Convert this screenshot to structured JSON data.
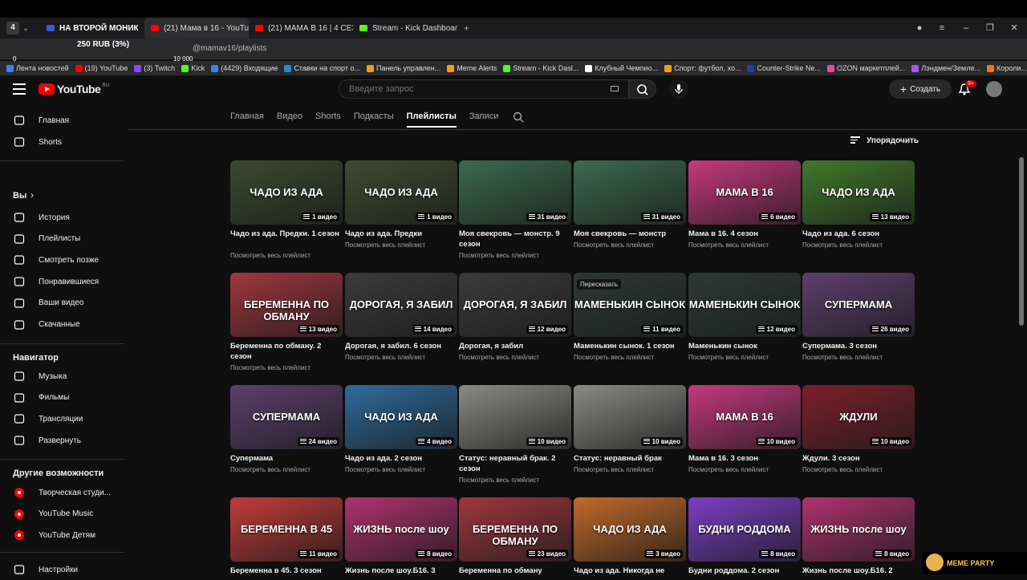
{
  "browser": {
    "tab_count_badge": "4",
    "tabs": [
      {
        "label": "НА ВТОРОЙ МОНИК",
        "color": "#3b5bdb"
      },
      {
        "label": "(21) Мама в 16 - YouTube",
        "color": "#ff0000",
        "active": true
      },
      {
        "label": "(21) МАМА В 16 | 4 СЕЗОН",
        "color": "#ff0000"
      },
      {
        "label": "Stream - Kick Dashboard",
        "color": "#53fc18"
      }
    ],
    "address": "@mamav16/playlists",
    "overlay_money": "250 RUB (3%)",
    "overlay_min": "0",
    "overlay_max": "10 000",
    "bookmarks": [
      {
        "label": "Лента новостей",
        "color": "#3b82f6"
      },
      {
        "label": "(19) YouTube",
        "color": "#ff0000"
      },
      {
        "label": "(3) Twitch",
        "color": "#9146ff"
      },
      {
        "label": "Kick",
        "color": "#53fc18"
      },
      {
        "label": "(4429) Входящие",
        "color": "#3b82f6"
      },
      {
        "label": "Ставки на спорт о...",
        "color": "#2a8bd5"
      },
      {
        "label": "Панель управлен...",
        "color": "#f59e0b"
      },
      {
        "label": "Meme Alerts",
        "color": "#f59e0b"
      },
      {
        "label": "Stream - Kick Dasl...",
        "color": "#53fc18"
      },
      {
        "label": "Клубный Чемпио...",
        "color": "#ffffff"
      },
      {
        "label": "Спорт: футбол, хо...",
        "color": "#f59e0b"
      },
      {
        "label": "Counter-Strike Ne...",
        "color": "#1e40af"
      },
      {
        "label": "OZON маркетплей...",
        "color": "#ec4899"
      },
      {
        "label": "Лэндмен/Земле...",
        "color": "#a855f7"
      },
      {
        "label": "Короли...",
        "color": "#f97316"
      }
    ]
  },
  "masthead": {
    "logo_text": "YouTube",
    "logo_region": "RU",
    "search_placeholder": "Введите запрос",
    "create_label": "Создать",
    "notif_count": "9+"
  },
  "sidebar": {
    "main": [
      {
        "label": "Главная",
        "icon": "home-icon"
      },
      {
        "label": "Shorts",
        "icon": "shorts-icon"
      }
    ],
    "you_header": "Вы",
    "you": [
      {
        "label": "История",
        "icon": "history-icon"
      },
      {
        "label": "Плейлисты",
        "icon": "playlists-icon"
      },
      {
        "label": "Смотреть позже",
        "icon": "clock-icon"
      },
      {
        "label": "Понравившиеся",
        "icon": "thumbs-up-icon"
      },
      {
        "label": "Ваши видео",
        "icon": "video-icon"
      },
      {
        "label": "Скачанные",
        "icon": "download-icon"
      }
    ],
    "nav_header": "Навигатор",
    "nav": [
      {
        "label": "Музыка",
        "icon": "music-icon"
      },
      {
        "label": "Фильмы",
        "icon": "film-icon"
      },
      {
        "label": "Трансляции",
        "icon": "live-icon"
      },
      {
        "label": "Развернуть",
        "icon": "chevron-down-icon"
      }
    ],
    "more_header": "Другие возможности",
    "more": [
      {
        "label": "Творческая студи...",
        "icon": "studio-icon"
      },
      {
        "label": "YouTube Music",
        "icon": "yt-music-icon"
      },
      {
        "label": "YouTube Детям",
        "icon": "yt-kids-icon"
      }
    ],
    "settings": "Настройки"
  },
  "channel_tabs": [
    "Главная",
    "Видео",
    "Shorts",
    "Подкасты",
    "Плейлисты",
    "Записи"
  ],
  "active_tab": "Плейлисты",
  "sort_label": "Упорядочить",
  "see_all": "Посмотреть весь плейлист",
  "playlists": [
    {
      "title": "Чадо из ада. Предки. 1 сезон",
      "count": "1 видео",
      "bg": "#3b4a2e",
      "art": "ЧАДО ИЗ АДА",
      "two_line": true
    },
    {
      "title": "Чадо из ада. Предки",
      "count": "1 видео",
      "bg": "#3e4b30",
      "art": "ЧАДО ИЗ АДА",
      "two_line": false
    },
    {
      "title": "Моя свекровь — монстр. 9 сезон",
      "count": "31 видео",
      "bg": "#3a6b4f",
      "art": "",
      "two_line": true
    },
    {
      "title": "Моя свекровь — монстр",
      "count": "31 видео",
      "bg": "#3a6b4f",
      "art": "",
      "two_line": false
    },
    {
      "title": "Мама в 16. 4 сезон",
      "count": "6 видео",
      "bg": "#c7387f",
      "art": "МАМА В 16",
      "two_line": false
    },
    {
      "title": "Чадо из ада. 6 сезон",
      "count": "13 видео",
      "bg": "#3f7a2a",
      "art": "ЧАДО ИЗ АДА",
      "two_line": false
    },
    {
      "title": "Беременна по обману. 2 сезон",
      "count": "13 видео",
      "bg": "#a0373f",
      "art": "БЕРЕМЕННА ПО ОБМАНУ",
      "two_line": true
    },
    {
      "title": "Дорогая, я забил. 6 сезон",
      "count": "14 видео",
      "bg": "#3b3b3b",
      "art": "ДОРОГАЯ, Я ЗАБИЛ",
      "two_line": false
    },
    {
      "title": "Дорогая, я забил",
      "count": "12 видео",
      "bg": "#3b3b3b",
      "art": "ДОРОГАЯ, Я ЗАБИЛ",
      "two_line": false
    },
    {
      "title": "Маменькин сынок. 1 сезон",
      "count": "11 видео",
      "bg": "#2c3a34",
      "art": "МАМЕНЬКИН СЫНОК",
      "two_line": false
    },
    {
      "title": "Маменькин сынок",
      "count": "12 видео",
      "bg": "#2c3a34",
      "art": "МАМЕНЬКИН СЫНОК",
      "two_line": false
    },
    {
      "title": "Супермама. 3 сезон",
      "count": "26 видео",
      "bg": "#5e3f6e",
      "art": "СУПЕРМАМА",
      "two_line": false
    },
    {
      "title": "Супермама",
      "count": "24 видео",
      "bg": "#5e3f6e",
      "art": "СУПЕРМАМА",
      "two_line": false
    },
    {
      "title": "Чадо из ада. 2 сезон",
      "count": "4 видео",
      "bg": "#2e6c9e",
      "art": "ЧАДО ИЗ АДА",
      "two_line": false
    },
    {
      "title": "Статус: неравный брак. 2 сезон",
      "count": "10 видео",
      "bg": "#8a8a86",
      "art": "",
      "two_line": true
    },
    {
      "title": "Статус: неравный брак",
      "count": "10 видео",
      "bg": "#8a8a86",
      "art": "",
      "two_line": false
    },
    {
      "title": "Мама в 16. 3 сезон",
      "count": "10 видео",
      "bg": "#c7387f",
      "art": "МАМА В 16",
      "two_line": false
    },
    {
      "title": "Ждули. 3 сезон",
      "count": "10 видео",
      "bg": "#7d1f2a",
      "art": "ЖДУЛИ",
      "two_line": false
    },
    {
      "title": "Беременна в 45. 3 сезон",
      "count": "11 видео",
      "bg": "#c23c39",
      "art": "БЕРЕМЕННА В 45",
      "two_line": false
    },
    {
      "title": "Жизнь после шоу.Б16. 3",
      "count": "8 видео",
      "bg": "#b0326f",
      "art": "ЖИЗНЬ после шоу",
      "two_line": false
    },
    {
      "title": "Беременна по обману",
      "count": "23 видео",
      "bg": "#a0373f",
      "art": "БЕРЕМЕННА ПО ОБМАНУ",
      "two_line": false
    },
    {
      "title": "Чадо из ада. Никогда не",
      "count": "3 видео",
      "bg": "#c26a2a",
      "art": "ЧАДО ИЗ АДА",
      "two_line": false
    },
    {
      "title": "Будни роддома. 2 сезон",
      "count": "8 видео",
      "bg": "#7b3fc4",
      "art": "БУДНИ РОДДОМА",
      "two_line": false
    },
    {
      "title": "Жизнь после шоу.Б16. 2",
      "count": "8 видео",
      "bg": "#b0326f",
      "art": "ЖИЗНЬ после шоу",
      "two_line": false
    }
  ],
  "pereskazat": "Пересказать",
  "meme_party": "MEME PARTY"
}
